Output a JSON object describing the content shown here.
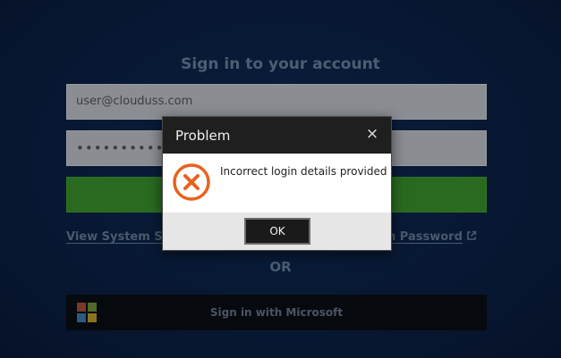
{
  "login": {
    "title": "Sign in to your account",
    "email_value": "user@clouduss.com",
    "password_value": "••••••••••",
    "view_status_link": "View System Sta",
    "forgotten_link": "ten Password",
    "or_text": "OR",
    "microsoft_button": "Sign in with Microsoft"
  },
  "dialog": {
    "title": "Problem",
    "close_glyph": "×",
    "message": "Incorrect login details provided",
    "ok_label": "OK"
  },
  "colors": {
    "background": "#081833",
    "signin_green": "#2a6a20",
    "error_orange": "#e8621c",
    "dialog_header": "#1f1f1f"
  },
  "icons": {
    "error": "error-x-circle-icon",
    "external_link": "external-link-icon",
    "microsoft_logo": "microsoft-logo"
  }
}
